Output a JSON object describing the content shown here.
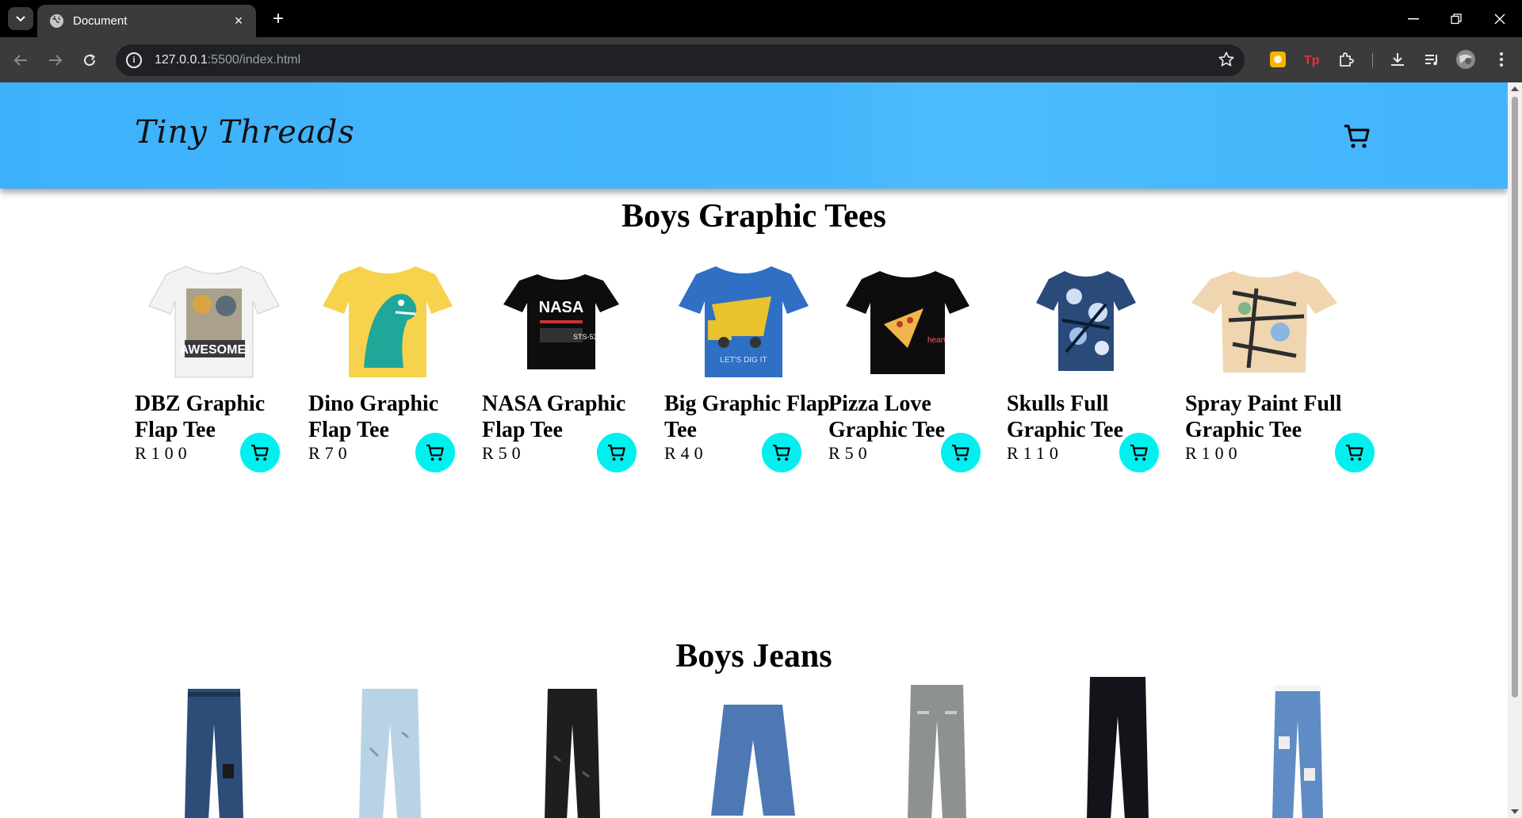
{
  "browser": {
    "tab_title": "Document",
    "new_tab_label": "+",
    "close_tab_label": "×",
    "url_host": "127.0.0.1",
    "url_path": ":5500/index.html"
  },
  "site": {
    "logo": "Tiny Threads"
  },
  "sections": [
    {
      "title": "Boys Graphic Tees",
      "products": [
        {
          "name": "DBZ Graphic Flap Tee",
          "price": "R100",
          "image": "white-tee-anime"
        },
        {
          "name": "Dino Graphic Flap Tee",
          "price": "R70",
          "image": "yellow-tee-dino"
        },
        {
          "name": "NASA Graphic Flap Tee",
          "price": "R50",
          "image": "black-tee-nasa"
        },
        {
          "name": "Big Graphic Flap Tee",
          "price": "R40",
          "image": "blue-tee-truck"
        },
        {
          "name": "Pizza Love Graphic Tee",
          "price": "R50",
          "image": "black-tee-pizza"
        },
        {
          "name": "Skulls Full Graphic Tee",
          "price": "R110",
          "image": "navy-tee-skulls"
        },
        {
          "name": "Spray Paint Full Graphic Tee",
          "price": "R100",
          "image": "beige-tee-graffiti"
        }
      ]
    },
    {
      "title": "Boys Jeans",
      "products": [
        {
          "image": "dark-blue-jogger-jeans"
        },
        {
          "image": "light-blue-ripped-jeans"
        },
        {
          "image": "black-ripped-jeans"
        },
        {
          "image": "mid-blue-shorts-jeans"
        },
        {
          "image": "grey-wash-jeans"
        },
        {
          "image": "black-straight-jeans"
        },
        {
          "image": "patched-blue-jeans"
        }
      ]
    }
  ],
  "colors": {
    "header": "#43b5fc",
    "cart_button": "#00f0f0"
  }
}
